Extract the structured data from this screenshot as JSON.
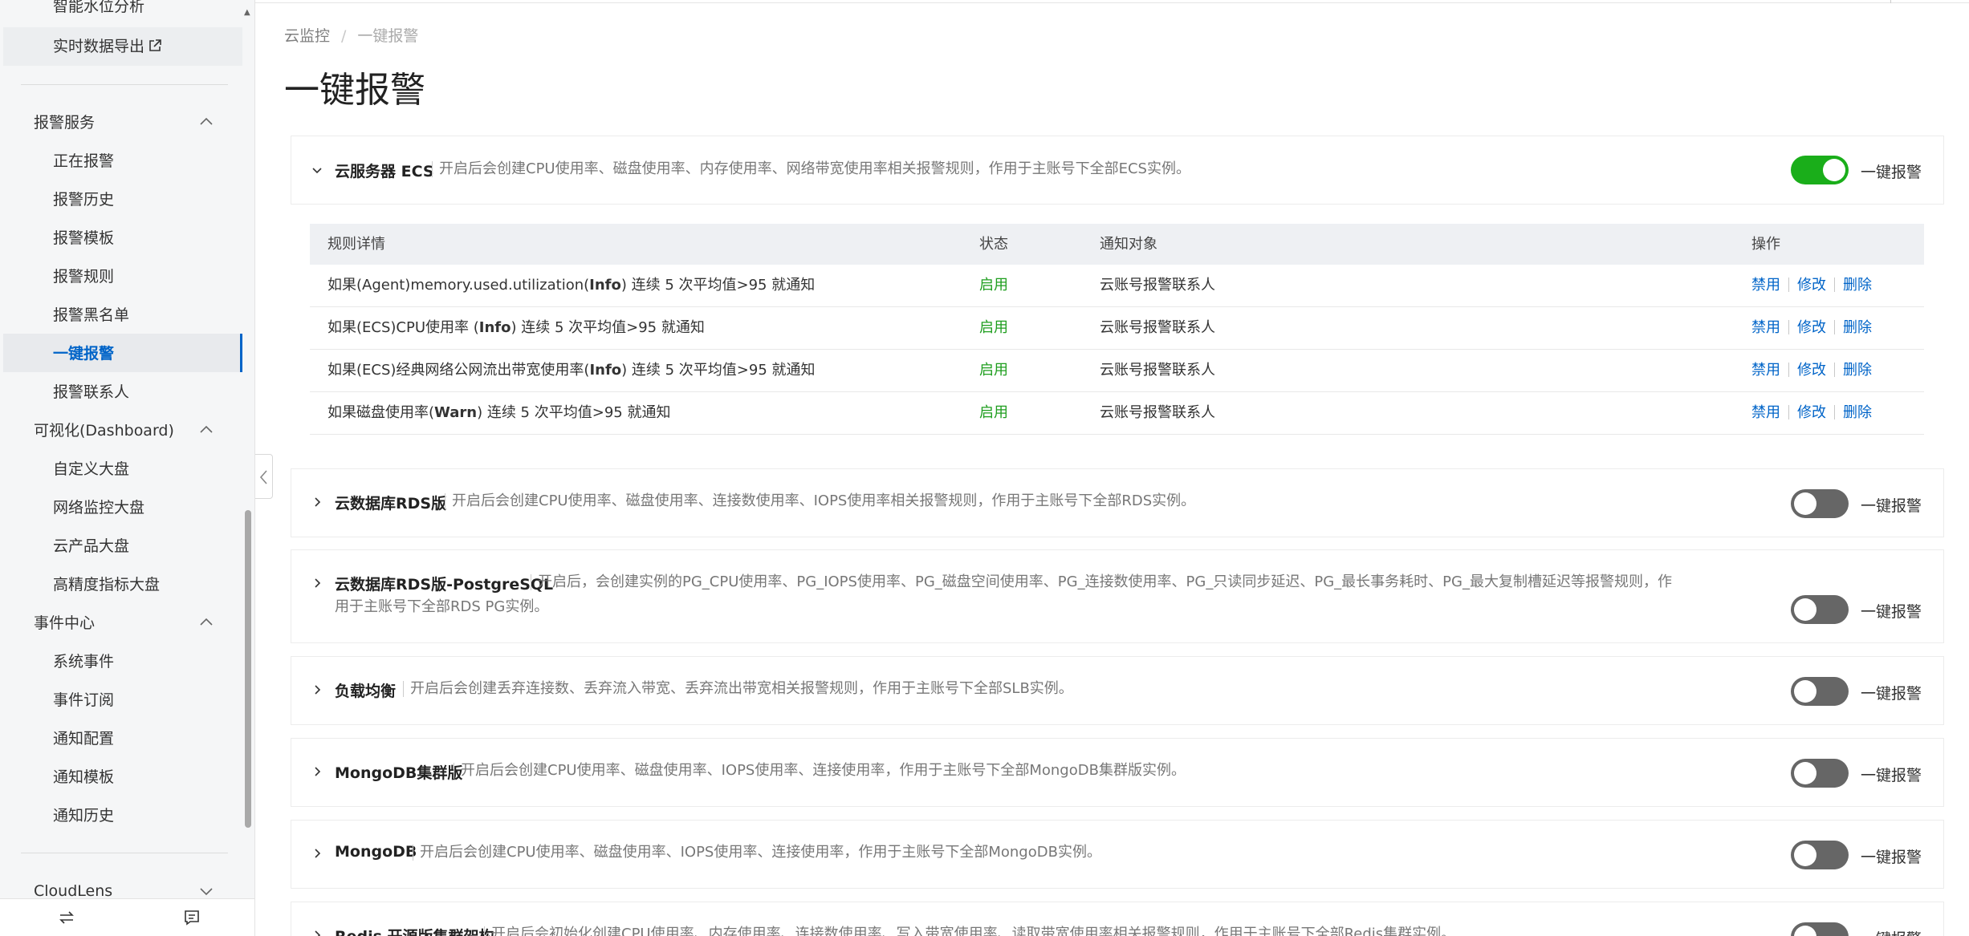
{
  "sidebar": {
    "top_item": "智能水位分析",
    "export_item": "实时数据导出",
    "groups": {
      "alarm_service": "报警服务",
      "dashboard": "可视化(Dashboard)",
      "event_center": "事件中心",
      "cloudlens": "CloudLens"
    },
    "alarm_items": [
      "正在报警",
      "报警历史",
      "报警模板",
      "报警规则",
      "报警黑名单",
      "一键报警",
      "报警联系人"
    ],
    "dashboard_items": [
      "自定义大盘",
      "网络监控大盘",
      "云产品大盘",
      "高精度指标大盘"
    ],
    "event_items": [
      "系统事件",
      "事件订阅",
      "通知配置",
      "通知模板",
      "通知历史"
    ]
  },
  "breadcrumb": {
    "root": "云监控",
    "separator": "/",
    "current": "一键报警"
  },
  "title": "一键报警",
  "toggle_label": "一键报警",
  "cards": [
    {
      "name": "云服务器 ECS",
      "desc": "开启后会创建CPU使用率、磁盘使用率、内存使用率、网络带宽使用率相关报警规则，作用于主账号下全部ECS实例。",
      "enabled": true
    },
    {
      "name": "云数据库RDS版",
      "desc": "开启后会创建CPU使用率、磁盘使用率、连接数使用率、IOPS使用率相关报警规则，作用于主账号下全部RDS实例。",
      "enabled": false
    },
    {
      "name": "云数据库RDS版-PostgreSQL",
      "desc": "开启后，会创建实例的PG_CPU使用率、PG_IOPS使用率、PG_磁盘空间使用率、PG_连接数使用率、PG_只读同步延迟、PG_最长事务耗时、PG_最大复制槽延迟等报警规则，作",
      "desc2": "用于主账号下全部RDS PG实例。",
      "enabled": false
    },
    {
      "name": "负载均衡",
      "desc": "开启后会创建丢弃连接数、丢弃流入带宽、丢弃流出带宽相关报警规则，作用于主账号下全部SLB实例。",
      "enabled": false
    },
    {
      "name": "MongoDB集群版",
      "desc": "开启后会创建CPU使用率、磁盘使用率、IOPS使用率、连接使用率，作用于主账号下全部MongoDB集群版实例。",
      "enabled": false
    },
    {
      "name": "MongoDB",
      "desc": "开启后会创建CPU使用率、磁盘使用率、IOPS使用率、连接使用率，作用于主账号下全部MongoDB实例。",
      "enabled": false
    },
    {
      "name": "Redis 开源版集群架构",
      "desc": "开启后会初始化创建CPU使用率、内存使用率、连接数使用率、写入带宽使用率、读取带宽使用率相关报警规则，作用于主账号下全部Redis集群实例。",
      "enabled": false
    }
  ],
  "rules_table": {
    "headers": {
      "detail": "规则详情",
      "status": "状态",
      "notify": "通知对象",
      "ops": "操作"
    },
    "rows": [
      {
        "pre": "如果(Agent)memory.used.utilization(",
        "level": "Info",
        "post": ") 连续 5 次平均值>95 就通知",
        "status": "启用",
        "notify": "云账号报警联系人"
      },
      {
        "pre": "如果(ECS)CPU使用率 (",
        "level": "Info",
        "post": ") 连续 5 次平均值>95 就通知",
        "status": "启用",
        "notify": "云账号报警联系人"
      },
      {
        "pre": "如果(ECS)经典网络公网流出带宽使用率(",
        "level": "Info",
        "post": ") 连续 5 次平均值>95 就通知",
        "status": "启用",
        "notify": "云账号报警联系人"
      },
      {
        "pre": "如果磁盘使用率(",
        "level": "Warn",
        "post": ") 连续 5 次平均值>95 就通知",
        "status": "启用",
        "notify": "云账号报警联系人"
      }
    ],
    "ops": {
      "disable": "禁用",
      "edit": "修改",
      "delete": "删除"
    }
  },
  "colors": {
    "accent": "#0064c8",
    "toggle_on": "#1aae1a",
    "toggle_off": "#666666",
    "status_green": "#1e9e1e",
    "brand_orange": "#ff6a00"
  },
  "icons": [
    "external-link-icon",
    "chevron-up-icon",
    "chevron-down-icon",
    "chevron-right-icon",
    "swap-icon",
    "message-icon",
    "collapse-left-icon"
  ]
}
